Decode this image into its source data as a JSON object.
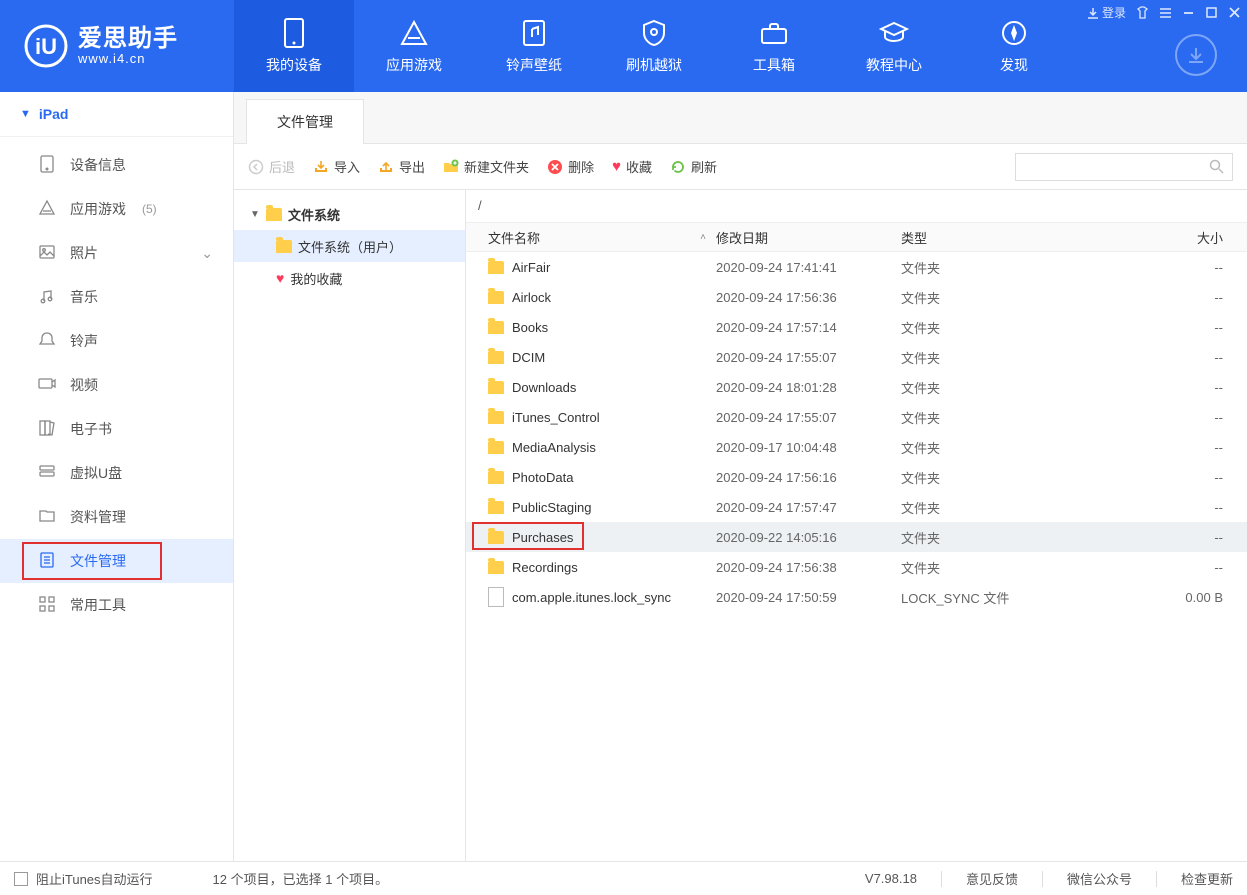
{
  "brand": {
    "name": "爱思助手",
    "url": "www.i4.cn"
  },
  "titlebar": {
    "login": "登录"
  },
  "topnav": [
    {
      "label": "我的设备"
    },
    {
      "label": "应用游戏"
    },
    {
      "label": "铃声壁纸"
    },
    {
      "label": "刷机越狱"
    },
    {
      "label": "工具箱"
    },
    {
      "label": "教程中心"
    },
    {
      "label": "发现"
    }
  ],
  "device": {
    "name": "iPad"
  },
  "sidebar": [
    {
      "label": "设备信息"
    },
    {
      "label": "应用游戏",
      "count": "(5)"
    },
    {
      "label": "照片",
      "expandable": true
    },
    {
      "label": "音乐"
    },
    {
      "label": "铃声"
    },
    {
      "label": "视频"
    },
    {
      "label": "电子书"
    },
    {
      "label": "虚拟U盘"
    },
    {
      "label": "资料管理"
    },
    {
      "label": "文件管理",
      "active": true
    },
    {
      "label": "常用工具"
    }
  ],
  "tab": {
    "label": "文件管理"
  },
  "toolbar": {
    "back": "后退",
    "import": "导入",
    "export": "导出",
    "newfolder": "新建文件夹",
    "delete": "删除",
    "favorite": "收藏",
    "refresh": "刷新"
  },
  "tree": {
    "root": "文件系统",
    "user": "文件系统（用户）",
    "fav": "我的收藏"
  },
  "path": "/",
  "columns": {
    "name": "文件名称",
    "date": "修改日期",
    "type": "类型",
    "size": "大小"
  },
  "type_folder": "文件夹",
  "rows": [
    {
      "name": "AirFair",
      "date": "2020-09-24 17:41:41",
      "type": "文件夹",
      "size": "--"
    },
    {
      "name": "Airlock",
      "date": "2020-09-24 17:56:36",
      "type": "文件夹",
      "size": "--"
    },
    {
      "name": "Books",
      "date": "2020-09-24 17:57:14",
      "type": "文件夹",
      "size": "--"
    },
    {
      "name": "DCIM",
      "date": "2020-09-24 17:55:07",
      "type": "文件夹",
      "size": "--"
    },
    {
      "name": "Downloads",
      "date": "2020-09-24 18:01:28",
      "type": "文件夹",
      "size": "--"
    },
    {
      "name": "iTunes_Control",
      "date": "2020-09-24 17:55:07",
      "type": "文件夹",
      "size": "--"
    },
    {
      "name": "MediaAnalysis",
      "date": "2020-09-17 10:04:48",
      "type": "文件夹",
      "size": "--"
    },
    {
      "name": "PhotoData",
      "date": "2020-09-24 17:56:16",
      "type": "文件夹",
      "size": "--"
    },
    {
      "name": "PublicStaging",
      "date": "2020-09-24 17:57:47",
      "type": "文件夹",
      "size": "--"
    },
    {
      "name": "Purchases",
      "date": "2020-09-22 14:05:16",
      "type": "文件夹",
      "size": "--",
      "selected": true,
      "highlight": true
    },
    {
      "name": "Recordings",
      "date": "2020-09-24 17:56:38",
      "type": "文件夹",
      "size": "--"
    },
    {
      "name": "com.apple.itunes.lock_sync",
      "date": "2020-09-24 17:50:59",
      "type": "LOCK_SYNC 文件",
      "size": "0.00 B",
      "isfile": true
    }
  ],
  "status": {
    "blockitunes": "阻止iTunes自动运行",
    "summary": "12 个项目，已选择 1 个项目。",
    "version": "V7.98.18",
    "feedback": "意见反馈",
    "wechat": "微信公众号",
    "update": "检查更新"
  }
}
